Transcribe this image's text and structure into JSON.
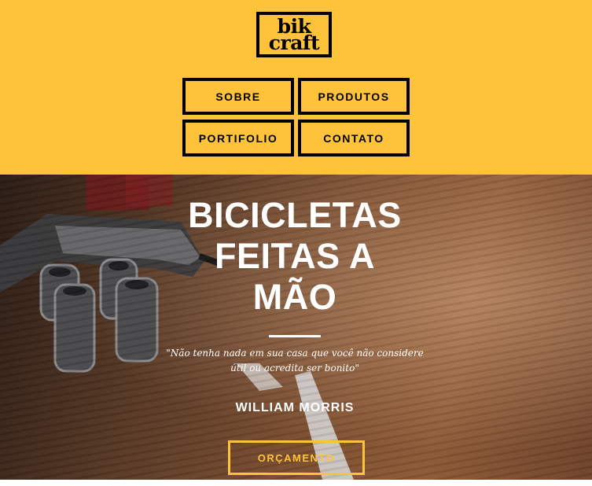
{
  "brand": {
    "logo_line1": "bik",
    "logo_line2": "craft"
  },
  "nav": {
    "items": [
      "SOBRE",
      "PRODUTOS",
      "PORTIFOLIO",
      "CONTATO"
    ]
  },
  "hero": {
    "title_lines": [
      "BICICLETAS",
      "FEITAS A",
      "MÃO"
    ],
    "quote": "\"Não tenha nada em sua casa que você não considere útil ou acredita ser bonito\"",
    "author": "WILLIAM MORRIS",
    "cta_label": "ORÇAMENTO"
  },
  "colors": {
    "accent": "#fec33b",
    "text_dark": "#000000",
    "text_light": "#ffffff"
  }
}
